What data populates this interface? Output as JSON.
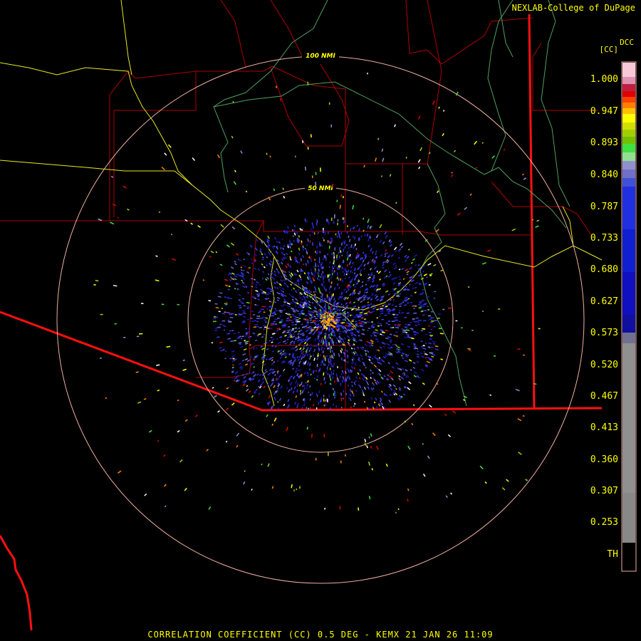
{
  "credit": "NEXLAB-College of DuPage",
  "product_title": "CORRELATION COEFFICIENT (CC) 0.5 DEG - KEMX 21 JAN 26 11:09",
  "colorbar": {
    "code": "DCC",
    "unit": "[CC]",
    "labels": [
      "1.000",
      "0.947",
      "0.893",
      "0.840",
      "0.787",
      "0.733",
      "0.680",
      "0.627",
      "0.573",
      "0.520",
      "0.467",
      "0.413",
      "0.360",
      "0.307",
      "0.253",
      "TH"
    ]
  },
  "range_rings": [
    "100 NMI",
    "50 NMI"
  ],
  "colors": {
    "label_yellow": "#ffff00",
    "county_border": "#b00000",
    "state_border": "#ff1010",
    "highway": "#e8e820",
    "river": "#4fa060",
    "range_ring": "#f0b0a0",
    "return_blue": "#3030e0"
  }
}
